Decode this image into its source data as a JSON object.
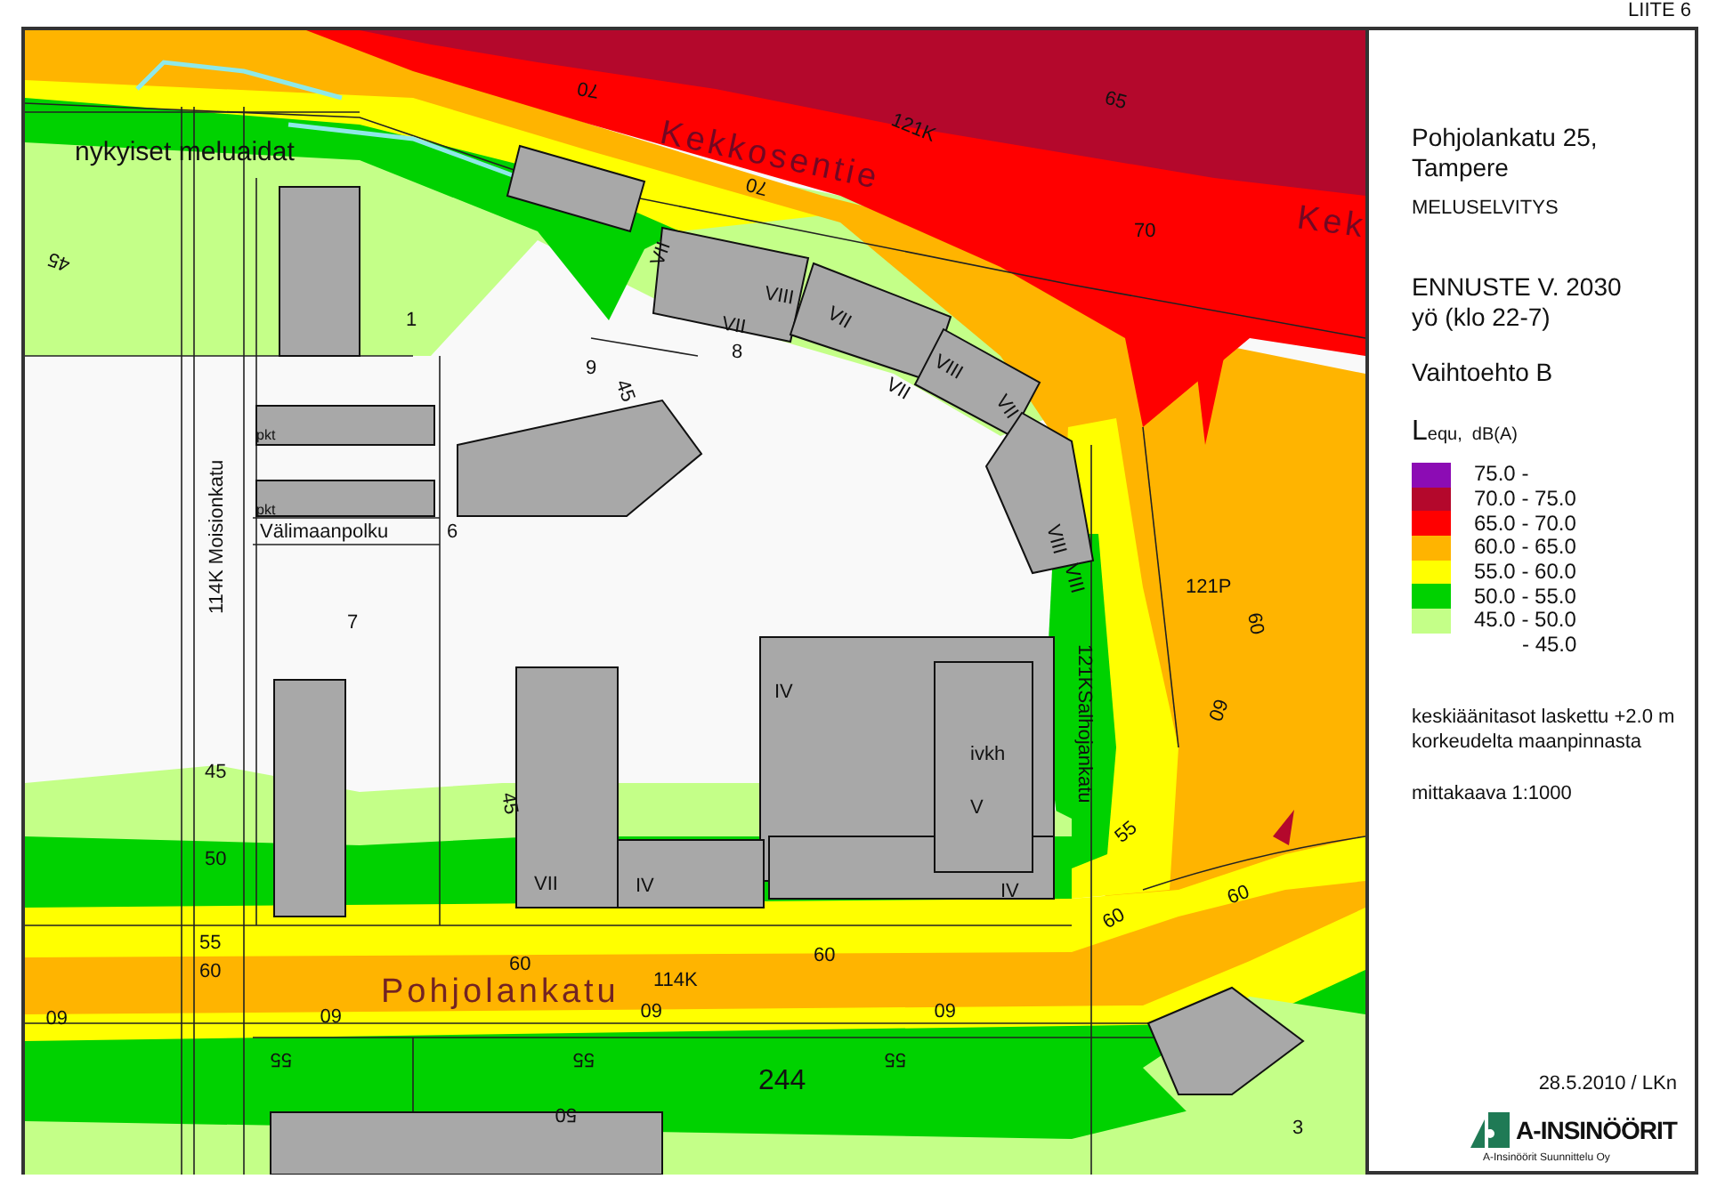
{
  "sheet_label": "LIITE 6",
  "map_labels": [
    {
      "kind": "note",
      "text": "nykyiset meluaidat"
    },
    {
      "kind": "street",
      "text": "Kekkosentie"
    },
    {
      "kind": "street",
      "text": "Kek"
    },
    {
      "kind": "plot",
      "text": "121K"
    },
    {
      "kind": "plot",
      "text": "1"
    },
    {
      "kind": "plot",
      "text": "9"
    },
    {
      "kind": "plot",
      "text": "8"
    },
    {
      "kind": "building",
      "text": "VII"
    },
    {
      "kind": "building",
      "text": "VIII"
    },
    {
      "kind": "building",
      "text": "VII"
    },
    {
      "kind": "building",
      "text": "VII"
    },
    {
      "kind": "building",
      "text": "VIII"
    },
    {
      "kind": "building",
      "text": "VII"
    },
    {
      "kind": "building",
      "text": "VII"
    },
    {
      "kind": "building",
      "text": "VIII"
    },
    {
      "kind": "building",
      "text": "VIII"
    },
    {
      "kind": "small",
      "text": "pkt"
    },
    {
      "kind": "small",
      "text": "pkt"
    },
    {
      "kind": "plot",
      "text": "Välimaanpolku"
    },
    {
      "kind": "plot",
      "text": "6"
    },
    {
      "kind": "plot",
      "text": "114K  Moisionkatu"
    },
    {
      "kind": "plot",
      "text": "7"
    },
    {
      "kind": "building",
      "text": "IV"
    },
    {
      "kind": "building",
      "text": "ivkh"
    },
    {
      "kind": "building",
      "text": "V"
    },
    {
      "kind": "plot",
      "text": "121KSalhojankatu"
    },
    {
      "kind": "plot",
      "text": "121P"
    },
    {
      "kind": "building",
      "text": "VII"
    },
    {
      "kind": "building",
      "text": "IV"
    },
    {
      "kind": "building",
      "text": "IV"
    },
    {
      "kind": "street",
      "text": "Pohjolankatu"
    },
    {
      "kind": "plot",
      "text": "114K"
    },
    {
      "kind": "block",
      "text": "244"
    },
    {
      "kind": "plot",
      "text": "3"
    },
    {
      "kind": "contour",
      "text": "45"
    },
    {
      "kind": "contour",
      "text": "50"
    },
    {
      "kind": "contour",
      "text": "55"
    },
    {
      "kind": "contour",
      "text": "60"
    },
    {
      "kind": "contour",
      "text": "60"
    },
    {
      "kind": "contour",
      "text": "60"
    },
    {
      "kind": "contour",
      "text": "60"
    },
    {
      "kind": "contour",
      "text": "60"
    },
    {
      "kind": "contour",
      "text": "60"
    },
    {
      "kind": "contour",
      "text": "60"
    },
    {
      "kind": "contour",
      "text": "55"
    },
    {
      "kind": "contour",
      "text": "55"
    },
    {
      "kind": "contour",
      "text": "55"
    },
    {
      "kind": "contour",
      "text": "50"
    },
    {
      "kind": "contour",
      "text": "70"
    },
    {
      "kind": "contour",
      "text": "70"
    },
    {
      "kind": "contour",
      "text": "70"
    },
    {
      "kind": "contour",
      "text": "65"
    },
    {
      "kind": "contour",
      "text": "60"
    },
    {
      "kind": "contour",
      "text": "60"
    },
    {
      "kind": "contour",
      "text": "55"
    },
    {
      "kind": "contour",
      "text": "60"
    },
    {
      "kind": "contour",
      "text": "45"
    },
    {
      "kind": "contour",
      "text": "45"
    },
    {
      "kind": "contour",
      "text": "60"
    },
    {
      "kind": "contour",
      "text": "45"
    }
  ],
  "panel": {
    "title": "Pohjolankatu 25, Tampere",
    "subtitle": "MELUSELVITYS",
    "forecast": [
      "ENNUSTE V. 2030",
      "yö (klo 22-7)"
    ],
    "alternative": "Vaihtoehto B",
    "legend": {
      "symbol": "L",
      "unit": "equ,  dB(A)",
      "items": [
        {
          "label": "75.0 -",
          "color": "#8c0cb4"
        },
        {
          "label": "70.0 - 75.0",
          "color": "#b4082c"
        },
        {
          "label": "65.0 - 70.0",
          "color": "#ff0000"
        },
        {
          "label": "60.0 - 65.0",
          "color": "#ffb400"
        },
        {
          "label": "55.0 - 60.0",
          "color": "#ffff00"
        },
        {
          "label": "50.0 - 55.0",
          "color": "#00d200"
        },
        {
          "label": "45.0 - 50.0",
          "color": "#c4ff88"
        },
        {
          "label": "- 45.0"
        }
      ]
    },
    "note": "keskiäänitasot laskettu +2.0 m korkeudelta maanpinnasta",
    "scale": "mittakaava 1:1000",
    "date": "28.5.2010 / LKn",
    "company": "A-INSINÖÖRIT",
    "company_sub": "A-Insinöörit Suunnittelu Oy"
  }
}
